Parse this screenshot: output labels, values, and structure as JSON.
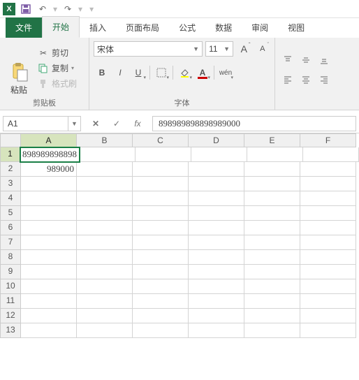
{
  "qat": {
    "undo": "↶",
    "redo": "↷",
    "saveColor": "#7f5ea7"
  },
  "tabs": {
    "file": "文件",
    "home": "开始",
    "insert": "插入",
    "layout": "页面布局",
    "formulas": "公式",
    "data": "数据",
    "review": "审阅",
    "view": "视图"
  },
  "clipboard": {
    "paste": "粘贴",
    "cut": "剪切",
    "copy": "复制",
    "format": "格式刷",
    "group": "剪贴板"
  },
  "font": {
    "name": "宋体",
    "size": "11",
    "group": "字体",
    "bold": "B",
    "italic": "I",
    "underline": "U",
    "wen": "wén"
  },
  "namebox": "A1",
  "formula": "898989898898989000",
  "fx": "fx",
  "columns": [
    "A",
    "B",
    "C",
    "D",
    "E",
    "F"
  ],
  "activeCol": 0,
  "activeRow": 1,
  "rows": 13,
  "cells": {
    "A1": "898989898898",
    "A2": "989000"
  }
}
